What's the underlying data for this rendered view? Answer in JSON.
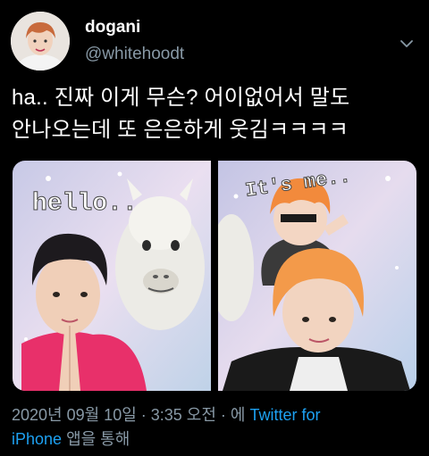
{
  "user": {
    "display_name": "dogani",
    "handle": "@whitehoodt",
    "avatar_icon": "profile-photo"
  },
  "tweet": {
    "line1": "ha.. 진짜 이게 무슨? 어이없어서 말도",
    "line2": "안나오는데 또 은은하게 웃김ㅋㅋㅋㅋ"
  },
  "media": {
    "left_caption": "hello..",
    "right_caption": "It's me.."
  },
  "meta": {
    "timestamp": "2020년 09월 10일 · 3:35 오전 · 에 ",
    "source_part1": "Twitter for",
    "source_part2": "iPhone",
    "suffix": " 앱을 통해"
  },
  "colors": {
    "background": "#000000",
    "secondary_text": "#8899a6",
    "link": "#1da1f2"
  }
}
